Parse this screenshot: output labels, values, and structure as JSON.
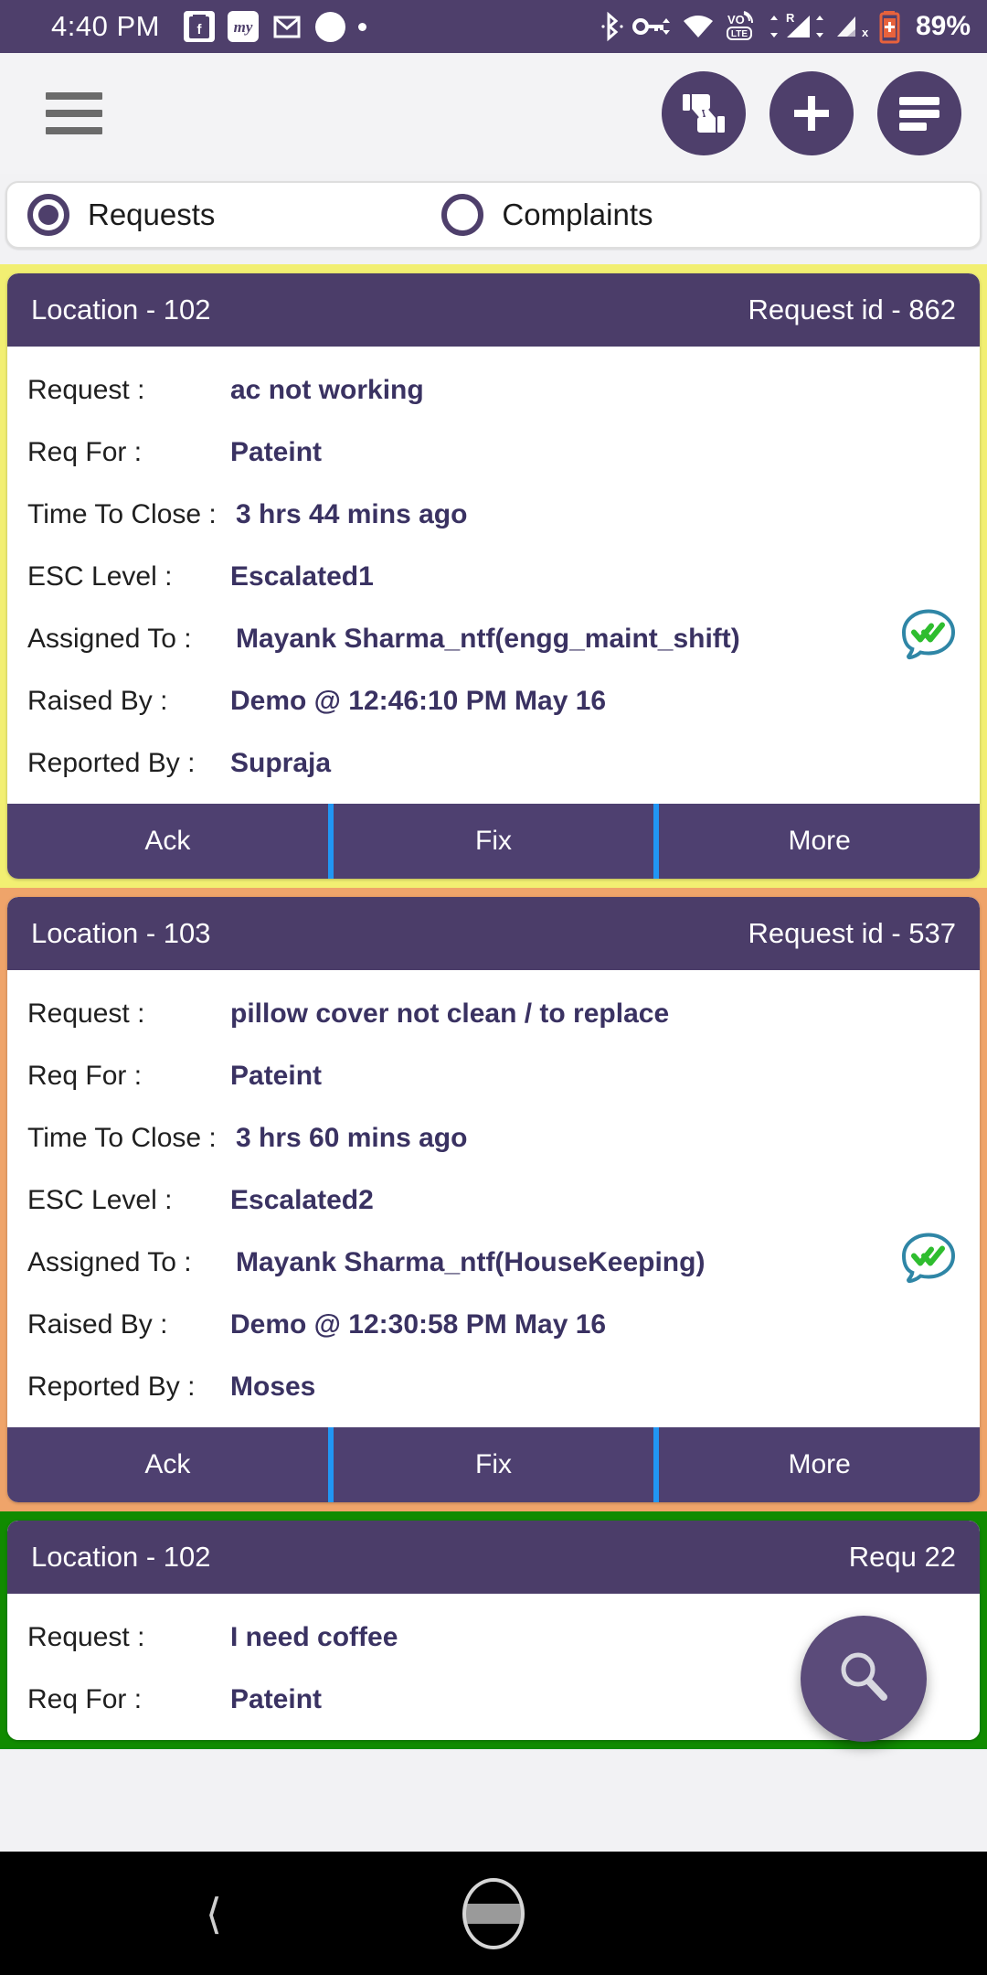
{
  "status_bar": {
    "time": "4:40 PM",
    "battery": "89%",
    "left_icons": [
      "flipkart-icon",
      "makemytrip-icon",
      "gmail-icon",
      "white-circle-icon",
      "dot-icon"
    ],
    "right_icons": [
      "bluetooth-icon",
      "vpn-key-icon",
      "wifi-icon",
      "volte-icon",
      "roaming-signal-icon",
      "signal-off-icon",
      "battery-charging-icon"
    ],
    "app_glyphs": {
      "flipkart": "F",
      "makemytrip": "my",
      "gmail": "M"
    }
  },
  "toolbar": {
    "menu_icon": "hamburger-icon",
    "feedback_icon": "thumbs-updown-icon",
    "add_icon": "plus-icon",
    "list_icon": "list-lines-icon"
  },
  "filter": {
    "options": [
      {
        "label": "Requests",
        "selected": true
      },
      {
        "label": "Complaints",
        "selected": false
      }
    ]
  },
  "labels": {
    "request": "Request :",
    "req_for": "Req  For :",
    "time_to_close": "Time To Close :",
    "esc_level": "ESC Level :",
    "assigned_to": "Assigned To :",
    "raised_by": "Raised By :",
    "reported_by": "Reported By :"
  },
  "actions": {
    "ack": "Ack",
    "fix": "Fix",
    "more": "More"
  },
  "cards": [
    {
      "border_color": "#f2ef72",
      "location": "Location - 102",
      "request_id": "Request id - 862",
      "request": "ac not working",
      "req_for": "Pateint",
      "time_to_close": "3 hrs 44 mins ago",
      "esc_level": "Escalated1",
      "assigned_to": "Mayank Sharma_ntf(engg_maint_shift)",
      "raised_by": "Demo @ 12:46:10 PM May 16",
      "reported_by": "Supraja",
      "whatsapp_icon": "whatsapp-double-tick-icon"
    },
    {
      "border_color": "#efa46a",
      "location": "Location - 103",
      "request_id": "Request id - 537",
      "request": "pillow cover not clean / to replace",
      "req_for": "Pateint",
      "time_to_close": "3 hrs 60 mins ago",
      "esc_level": "Escalated2",
      "assigned_to": "Mayank Sharma_ntf(HouseKeeping)",
      "raised_by": "Demo @ 12:30:58 PM May 16",
      "reported_by": "Moses",
      "whatsapp_icon": "whatsapp-double-tick-icon"
    },
    {
      "border_color": "#108b00",
      "location": "Location - 102",
      "request_id": "Requ        22",
      "request": "I need coffee",
      "req_for": "Pateint"
    }
  ],
  "fab": {
    "icon": "search-icon"
  },
  "nav_bar": {
    "back_icon": "back-chevron-icon",
    "home_icon": "home-pill-icon"
  },
  "colors": {
    "accent_purple": "#4e3f6b",
    "card_header": "#4b3d69",
    "value_text": "#3a3262",
    "divider_blue": "#2196f3"
  }
}
